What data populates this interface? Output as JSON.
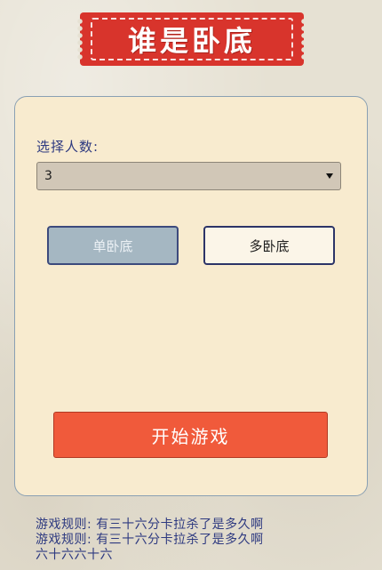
{
  "header": {
    "title": "谁是卧底"
  },
  "form": {
    "players_label": "选择人数:",
    "players_select_value": "3"
  },
  "modes": {
    "single_label": "单卧底",
    "multi_label": "多卧底",
    "selected": "单卧底"
  },
  "actions": {
    "start_label": "开始游戏"
  },
  "rules": {
    "lines": [
      "游戏规则: 有三十六分卡拉杀了是多久啊",
      "游戏规则: 有三十六分卡拉杀了是多久啊",
      "六十六六十六"
    ]
  },
  "colors": {
    "title_bg": "#d8342c",
    "card_bg": "#f8ebcf",
    "start_button": "#f05a3b",
    "selected_mode": "#a5b7c2",
    "label_text": "#2e3a80"
  },
  "icons": {
    "dropdown": "chevron-down-icon"
  }
}
